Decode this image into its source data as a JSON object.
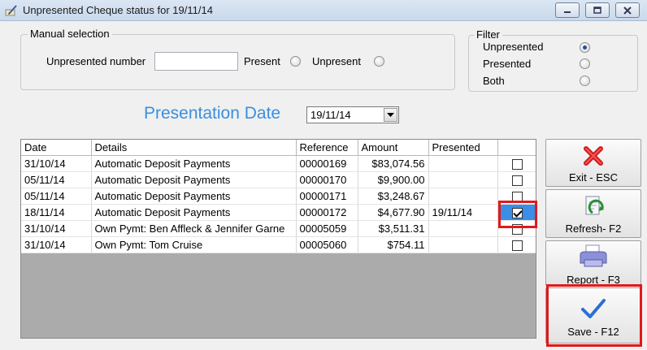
{
  "window": {
    "title": "Unpresented Cheque status for 19/11/14"
  },
  "manual_selection": {
    "group_label": "Manual selection",
    "unpresented_number_label": "Unpresented number",
    "unpresented_number_value": "",
    "present_label": "Present",
    "unpresent_label": "Unpresent"
  },
  "filter": {
    "group_label": "Filter",
    "options": [
      "Unpresented",
      "Presented",
      "Both"
    ],
    "selected": "Unpresented"
  },
  "presentation": {
    "label": "Presentation Date",
    "date": "19/11/14"
  },
  "table": {
    "columns": [
      "Date",
      "Details",
      "Reference",
      "Amount",
      "Presented",
      ""
    ],
    "rows": [
      {
        "date": "31/10/14",
        "details": "Automatic Deposit Payments",
        "reference": "00000169",
        "amount": "$83,074.56",
        "presented": "",
        "checked": false
      },
      {
        "date": "05/11/14",
        "details": "Automatic Deposit Payments",
        "reference": "00000170",
        "amount": "$9,900.00",
        "presented": "",
        "checked": false
      },
      {
        "date": "05/11/14",
        "details": "Automatic Deposit Payments",
        "reference": "00000171",
        "amount": "$3,248.67",
        "presented": "",
        "checked": false
      },
      {
        "date": "18/11/14",
        "details": "Automatic Deposit Payments",
        "reference": "00000172",
        "amount": "$4,677.90",
        "presented": "19/11/14",
        "checked": true
      },
      {
        "date": "31/10/14",
        "details": "Own Pymt: Ben Affleck & Jennifer Garne",
        "reference": "00005059",
        "amount": "$3,511.31",
        "presented": "",
        "checked": false
      },
      {
        "date": "31/10/14",
        "details": "Own Pymt: Tom Cruise",
        "reference": "00005060",
        "amount": "$754.11",
        "presented": "",
        "checked": false
      }
    ]
  },
  "buttons": {
    "exit": "Exit - ESC",
    "refresh": "Refresh- F2",
    "report": "Report - F3",
    "save": "Save - F12"
  },
  "colors": {
    "accent_text": "#3a8fdf",
    "highlight": "#e11919",
    "selection": "#3a8ee6"
  }
}
